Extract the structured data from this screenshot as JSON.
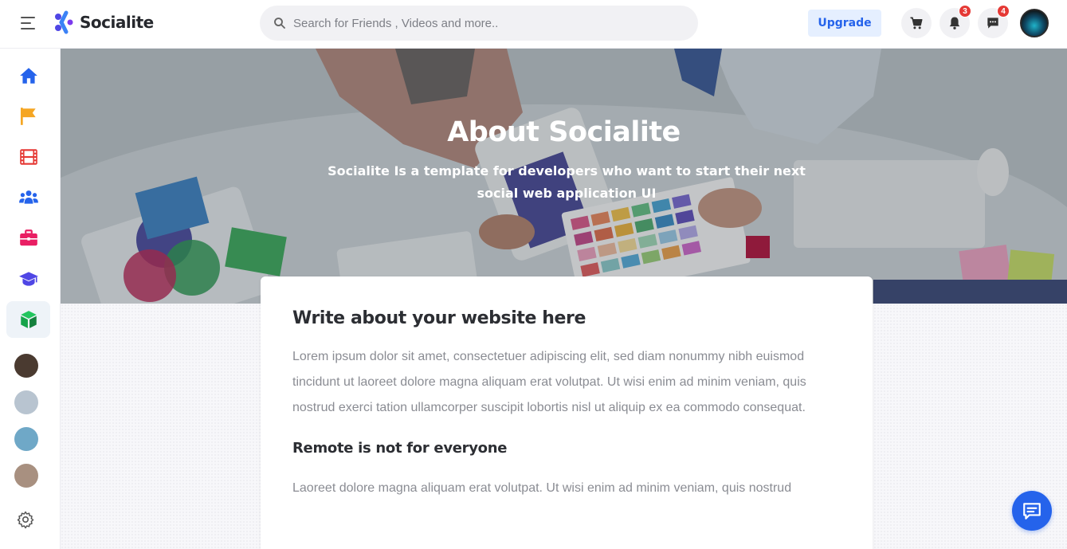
{
  "header": {
    "brand": "Socialite",
    "search_placeholder": "Search for Friends , Videos and more..",
    "upgrade_label": "Upgrade",
    "notifications_count": "3",
    "messages_count": "4"
  },
  "sidebar": {
    "items": [
      {
        "name": "home",
        "icon": "home-icon",
        "color": "#2563eb"
      },
      {
        "name": "pages",
        "icon": "flag-icon",
        "color": "#f5a623"
      },
      {
        "name": "videos",
        "icon": "film-icon",
        "color": "#e53935"
      },
      {
        "name": "groups",
        "icon": "users-icon",
        "color": "#2563eb"
      },
      {
        "name": "jobs",
        "icon": "briefcase-icon",
        "color": "#e91e63"
      },
      {
        "name": "courses",
        "icon": "graduation-cap-icon",
        "color": "#4f46e5"
      },
      {
        "name": "products",
        "icon": "cube-icon",
        "color": "#16a34a"
      }
    ],
    "active": "products",
    "contacts": 4
  },
  "hero": {
    "title": "About Socialite",
    "subtitle": "Socialite Is a template for developers who want to start their next social web application UI"
  },
  "content": {
    "heading": "Write about your website here",
    "paragraph": "Lorem ipsum dolor sit amet, consectetuer adipiscing elit, sed diam nonummy nibh euismod tincidunt ut laoreet dolore magna aliquam erat volutpat. Ut wisi enim ad minim veniam, quis nostrud exerci tation ullamcorper suscipit lobortis nisl ut aliquip ex ea commodo consequat.",
    "subheading": "Remote is not for everyone",
    "paragraph2": "Laoreet dolore magna aliquam erat volutpat. Ut wisi enim ad minim veniam, quis nostrud"
  },
  "colors": {
    "accent": "#2563eb",
    "badge": "#e53935"
  }
}
